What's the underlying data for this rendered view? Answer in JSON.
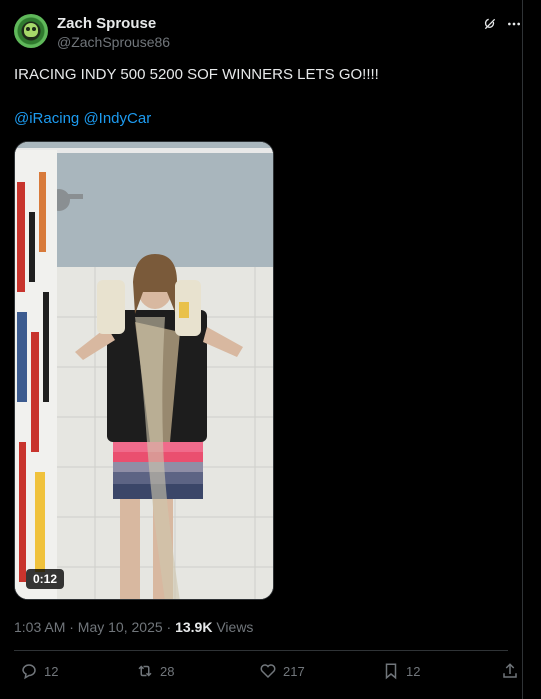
{
  "author": {
    "name": "Zach Sprouse",
    "handle": "@ZachSprouse86"
  },
  "tweet": {
    "text": "IRACING INDY 500 5200 SOF WINNERS LETS GO!!!!",
    "mentions": [
      "@iRacing",
      "@IndyCar"
    ]
  },
  "media": {
    "type": "video",
    "duration": "0:12"
  },
  "meta": {
    "time_date": "1:03 AM · May 10, 2025 · ",
    "views_count": "13.9K",
    "views_label": " Views"
  },
  "actions": {
    "replies": "12",
    "reposts": "28",
    "likes": "217",
    "bookmarks": "12"
  },
  "icons": {
    "header": [
      "grok-icon",
      "more-icon"
    ],
    "actions": [
      "reply-icon",
      "repost-icon",
      "like-icon",
      "bookmark-icon",
      "share-icon"
    ]
  },
  "colors": {
    "background": "#000000",
    "text": "#e7e9ea",
    "secondary": "#71767b",
    "link": "#1d9bf0",
    "divider": "#2f3336"
  }
}
